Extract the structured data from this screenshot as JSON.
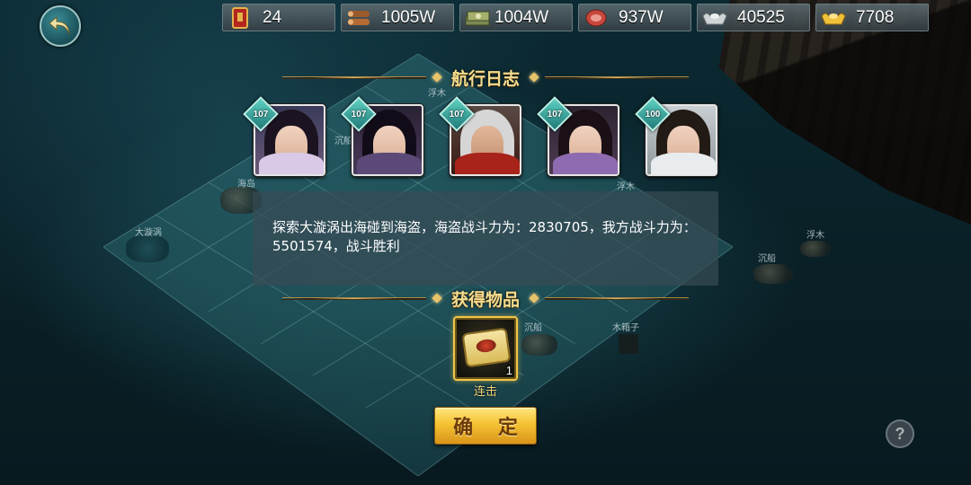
{
  "resources": [
    {
      "icon": "military-order-icon",
      "value": "24"
    },
    {
      "icon": "wood-logs-icon",
      "value": "1005W"
    },
    {
      "icon": "banknote-stack-icon",
      "value": "1004W"
    },
    {
      "icon": "meat-food-icon",
      "value": "937W"
    },
    {
      "icon": "silver-ingot-icon",
      "value": "40525"
    },
    {
      "icon": "gold-ingot-icon",
      "value": "7708"
    }
  ],
  "voyage_log": {
    "title": "航行日志",
    "heroes": [
      {
        "level": "107"
      },
      {
        "level": "107"
      },
      {
        "level": "107"
      },
      {
        "level": "107"
      },
      {
        "level": "100"
      }
    ],
    "message": "探索大漩涡出海碰到海盗，海盗战斗力为：2830705，我方战斗力为：5501574，战斗胜利"
  },
  "rewards": {
    "title": "获得物品",
    "items": [
      {
        "name": "连击",
        "count": "1"
      }
    ]
  },
  "confirm_label": "确 定",
  "help_label": "?",
  "map_labels": [
    "浮木",
    "沉船",
    "海岛",
    "大漩涡",
    "浮木",
    "沉船",
    "沉船",
    "木箱子",
    "浮木"
  ]
}
